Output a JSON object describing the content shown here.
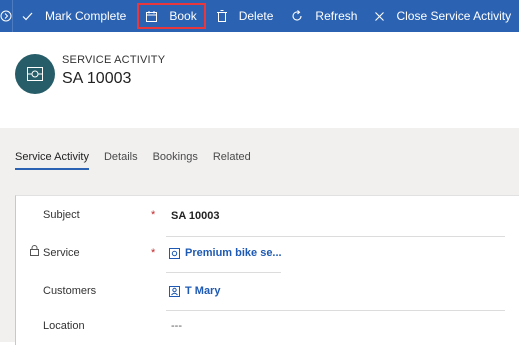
{
  "toolbar": {
    "mark_complete": "Mark Complete",
    "book": "Book",
    "delete": "Delete",
    "refresh": "Refresh",
    "close_activity": "Close Service Activity"
  },
  "header": {
    "entity_type": "SERVICE ACTIVITY",
    "title": "SA 10003"
  },
  "tabs": [
    "Service Activity",
    "Details",
    "Bookings",
    "Related"
  ],
  "form": {
    "subject": {
      "label": "Subject",
      "required": "*",
      "value": "SA 10003"
    },
    "service": {
      "label": "Service",
      "required": "*",
      "value": "Premium bike se..."
    },
    "customers": {
      "label": "Customers",
      "value": "T Mary"
    },
    "location": {
      "label": "Location",
      "value": "---"
    }
  },
  "colors": {
    "toolbar_bg": "#2b62b1",
    "avatar_bg": "#275d68",
    "highlight_border": "#e8383d",
    "link": "#1e5ab4",
    "required": "#c0292b"
  }
}
